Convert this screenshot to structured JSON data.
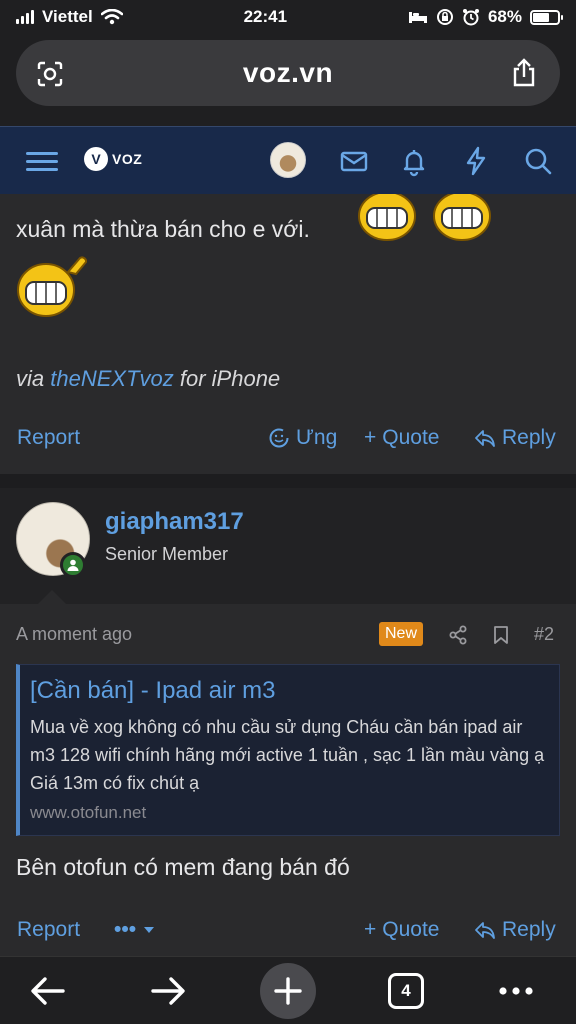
{
  "status": {
    "carrier": "Viettel",
    "time": "22:41",
    "battery": "68%",
    "battery_level": 0.68
  },
  "browser": {
    "url": "voz.vn"
  },
  "site": {
    "logo_text": "VOZ"
  },
  "post1": {
    "text_line": "xuân mà thừa bán cho e với.",
    "via_prefix": "via",
    "via_link": "theNEXTvoz",
    "via_suffix": "for iPhone",
    "actions": {
      "report": "Report",
      "react": "Ưng",
      "quote": "Quote",
      "reply": "Reply"
    }
  },
  "user": {
    "name": "giapham317",
    "title": "Senior Member"
  },
  "post2": {
    "time": "A moment ago",
    "badge": "New",
    "number": "#2",
    "embed": {
      "title": "[Cần bán] - Ipad air m3",
      "description": "Mua về xog không có nhu cầu sử dụng Cháu cần bán ipad air m3 128 wifi chính hãng mới active 1 tuần , sạc 1 lần màu vàng ạ Giá 13m có fix chút ạ",
      "site": "www.otofun.net"
    },
    "text": "Bên otofun có mem đang bán đó",
    "actions": {
      "report": "Report",
      "more": "•••",
      "quote": "Quote",
      "reply": "Reply"
    }
  },
  "toolbar": {
    "tabs_count": "4"
  },
  "colors": {
    "accent": "#5f9fe0",
    "nav_bg": "#18294a",
    "badge_new": "#e0891a",
    "online": "#2e7d32"
  }
}
